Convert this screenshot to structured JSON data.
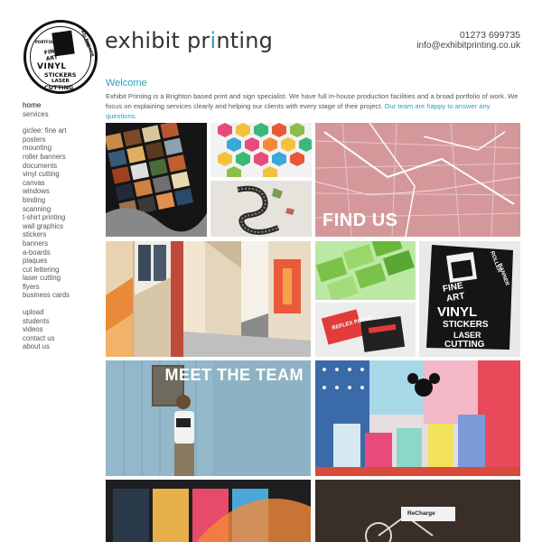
{
  "header": {
    "brand_pre": "exhibit pr",
    "brand_i": "i",
    "brand_post": "nting",
    "phone": "01273 699735",
    "email": "info@exhibitprinting.co.uk"
  },
  "logo": {
    "words": [
      "PORTFOLIO",
      "FINE",
      "ART",
      "ROLLER",
      "BANNER",
      "VINYL",
      "STICKERS",
      "LASER",
      "CUTTING"
    ]
  },
  "intro": {
    "heading": "Welcome",
    "body": "Exhibit Printing is a Brighton based print and sign specialist. We have full in-house production facilities and a broad portfolio of work. We focus on explaining services clearly and helping our clients with every stage of their project.",
    "link": "Our team are happy to answer any questions."
  },
  "nav": {
    "group1": [
      "home",
      "services"
    ],
    "group2": [
      "giclee: fine art",
      "posters",
      "mounting",
      "roller banners",
      "documents",
      "vinyl cutting",
      "canvas",
      "windows",
      "binding",
      "scanning",
      "t-shirt printing",
      "wall graphics",
      "stickers",
      "banners",
      "a-boards",
      "plaques",
      "cut lettering",
      "laser cutting",
      "flyers",
      "business cards"
    ],
    "group3": [
      "upload",
      "students",
      "videos",
      "contact us",
      "about us"
    ]
  },
  "tiles": {
    "find_us": "FIND US",
    "meet_team": "MEET THE TEAM",
    "sticker_words": [
      "ROLLER",
      "BANNER",
      "FINE",
      "ART",
      "VINYL",
      "STICKERS",
      "LASER",
      "CUTTING"
    ],
    "packaging_text": "REFLEX PARCH",
    "bike_text": "ReCharge"
  }
}
